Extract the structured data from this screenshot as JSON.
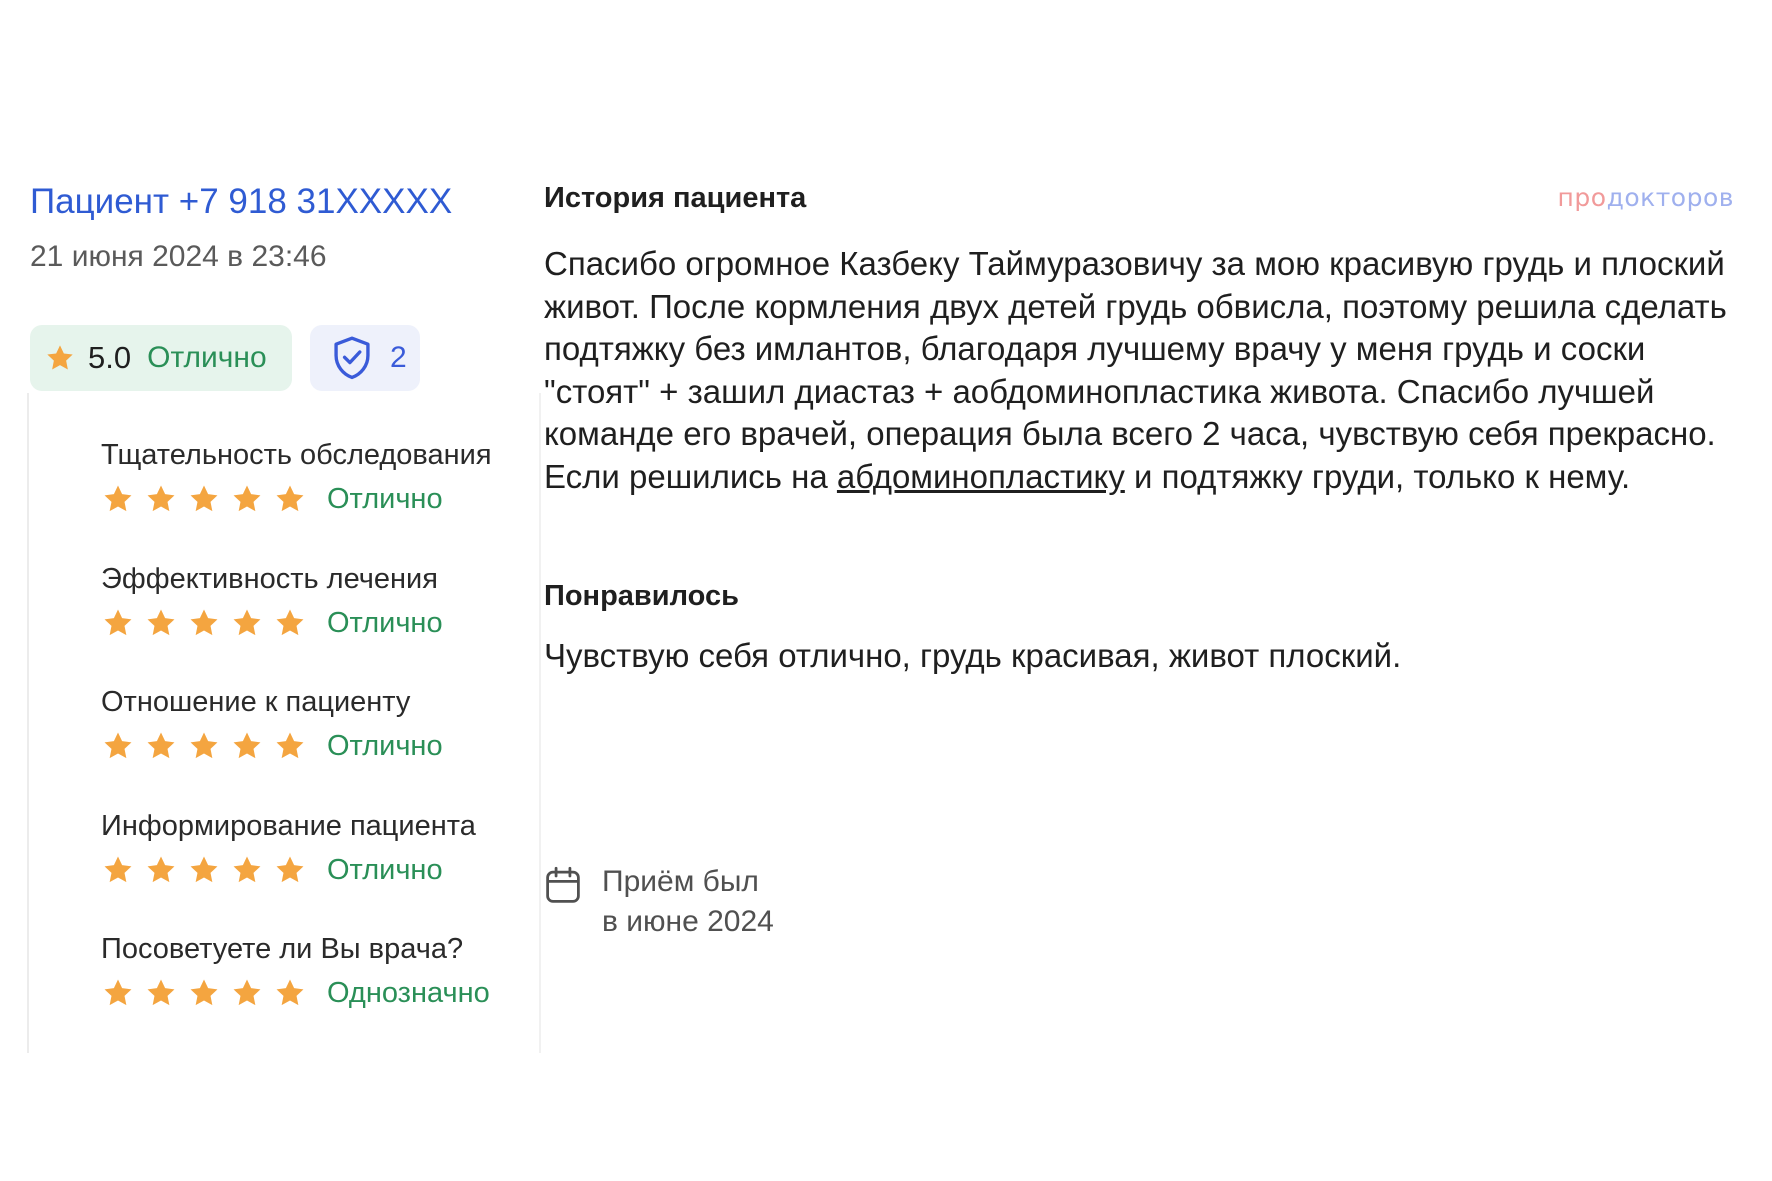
{
  "review": {
    "author": "Пациент +7 918 31XXXXX",
    "date": "21 июня 2024 в 23:46",
    "rating": {
      "score": "5.0",
      "verdict": "Отлично",
      "icon": "star-icon",
      "color": "#f4a540"
    },
    "verified": {
      "icon": "shield-check-icon",
      "count": "2"
    }
  },
  "criteria": [
    {
      "title": "Тщательность обследования",
      "stars": 5,
      "verdict": "Отлично"
    },
    {
      "title": "Эффективность лечения",
      "stars": 5,
      "verdict": "Отлично"
    },
    {
      "title": "Отношение к пациенту",
      "stars": 5,
      "verdict": "Отлично"
    },
    {
      "title": "Информирование пациента",
      "stars": 5,
      "verdict": "Отлично"
    },
    {
      "title": "Посоветуете ли Вы врача?",
      "stars": 5,
      "verdict": "Однозначно"
    }
  ],
  "brand": {
    "part1": "про",
    "part2": "докторов"
  },
  "story": {
    "heading": "История пациента",
    "text_before_link": "Спасибо огромное Казбеку Таймуразовичу за мою красивую грудь и плоский живот. После кормления двух детей грудь обвисла, поэтому решила сделать подтяжку без имлантов, благодаря лучшему врачу у меня грудь и соски \"стоят\" + зашил диастаз + аобдоминопластика живота. Спасибо лучшей команде его врачей, операция была всего 2 часа, чувствую себя прекрасно. Если решились на ",
    "link_text": "абдоминопластику",
    "text_after_link": " и подтяжку груди, только к нему."
  },
  "liked": {
    "heading": "Понравилось",
    "text": "Чувствую себя отлично, грудь красивая, живот плоский."
  },
  "visit": {
    "icon": "calendar-icon",
    "line1": "Приём был",
    "line2": "в июне 2024"
  },
  "colors": {
    "link_blue": "#2f5bd3",
    "positive_green": "#2a8f57",
    "star_orange": "#f4a540",
    "badge_green_bg": "#e6f4ec",
    "badge_blue_bg": "#eef1fb"
  }
}
